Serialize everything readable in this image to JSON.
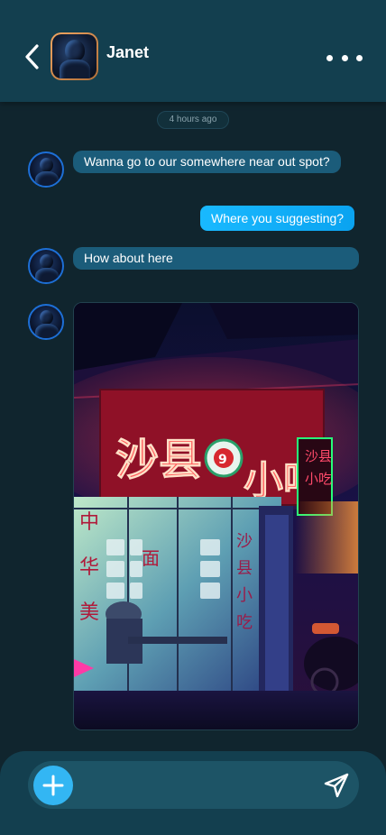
{
  "header": {
    "contact_name": "Janet",
    "back_icon": "chevron-left-icon",
    "more_icon": "more-horizontal-icon"
  },
  "conversation": {
    "timestamp": "4 hours ago",
    "messages": [
      {
        "direction": "incoming",
        "text": "Wanna go to our somewhere near out spot?"
      },
      {
        "direction": "outgoing",
        "text": "Where you suggesting?"
      },
      {
        "direction": "incoming",
        "text": "How about here"
      },
      {
        "direction": "incoming",
        "type": "image",
        "sign_text": "沙县小吃",
        "side_sign_text": "沙县小吃",
        "window_text": "中华美食"
      }
    ]
  },
  "composer": {
    "placeholder": "",
    "add_icon": "plus-icon",
    "send_icon": "send-icon"
  },
  "colors": {
    "background": "#10252e",
    "header": "#133f4f",
    "incoming_bubble": "#1b5c7a",
    "outgoing_bubble": "#19b9ff",
    "accent": "#33b6f3"
  }
}
